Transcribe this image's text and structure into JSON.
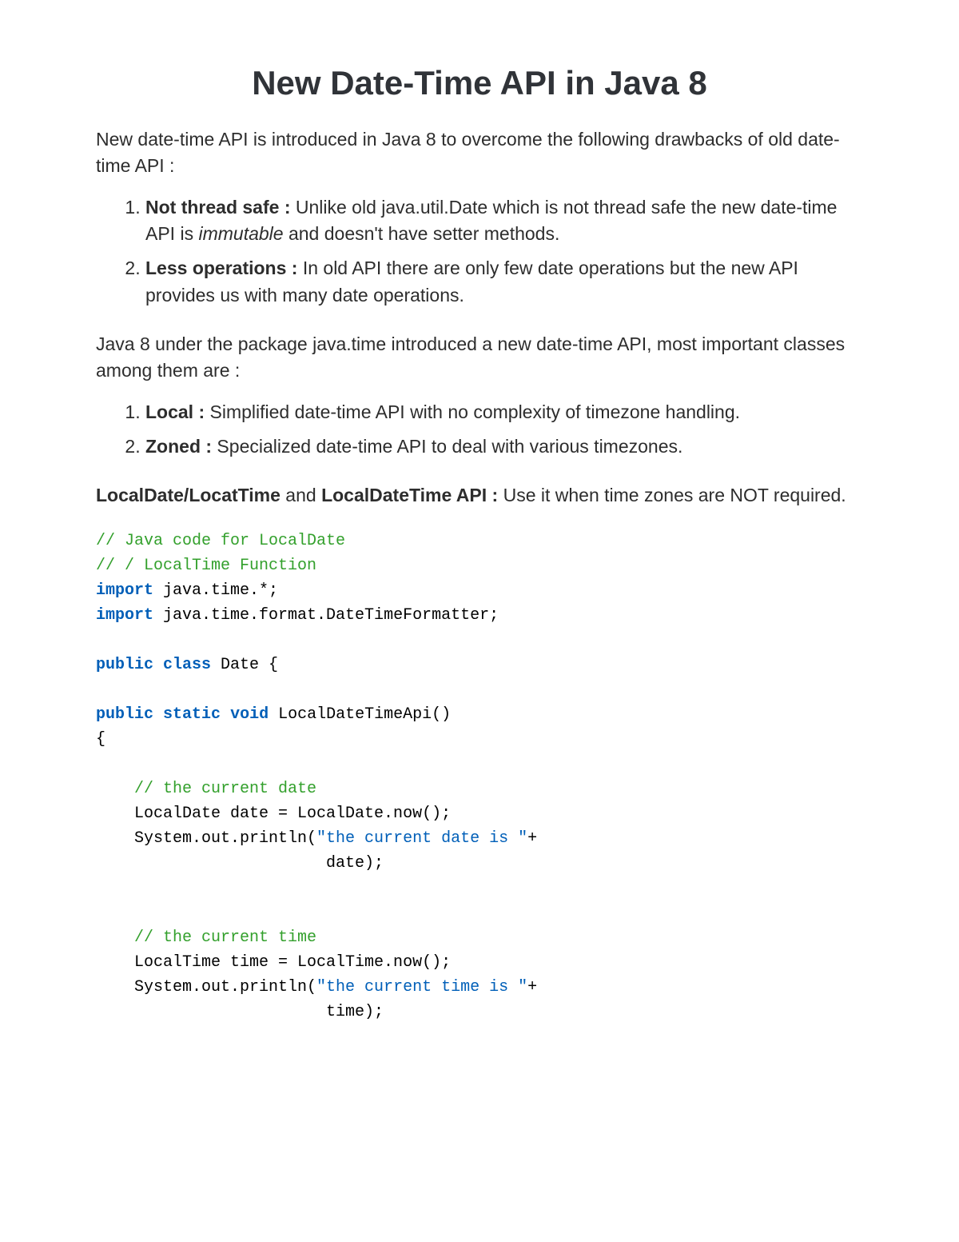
{
  "title": "New Date-Time API in Java 8",
  "intro": "New date-time API is introduced in Java 8 to overcome the following drawbacks of old date-time API :",
  "drawbacks": [
    {
      "label": "Not thread safe :",
      "text_before_em": " Unlike old java.util.Date which is not thread safe the new date-time API is ",
      "em": "immutable",
      "text_after_em": " and doesn't have setter methods."
    },
    {
      "label": "Less operations :",
      "text_before_em": " In old API there are only few date operations but the new API provides us with many date operations.",
      "em": "",
      "text_after_em": ""
    }
  ],
  "mid_para": "Java 8 under the package java.time introduced a new date-time API, most important classes among them are :",
  "classes": [
    {
      "label": "Local :",
      "text": " Simplified date-time API with no complexity of timezone handling."
    },
    {
      "label": "Zoned :",
      "text": " Specialized date-time API to deal with various timezones."
    }
  ],
  "api_line": {
    "bold1": "LocalDate/LocatTime",
    "mid": " and ",
    "bold2": "LocalDateTime API :",
    "tail": " Use it when time zones are NOT required."
  },
  "code": {
    "c1": "// Java code for LocalDate",
    "c2": "// / LocalTime Function",
    "kw_import": "import",
    "imp1": " java.time.*;",
    "imp2": " java.time.format.DateTimeFormatter;",
    "kw_public": "public",
    "kw_class": "class",
    "cls_decl": " Date {",
    "kw_static": "static",
    "kw_void": "void",
    "method_decl": " LocalDateTimeApi()",
    "brace_open": "{",
    "c3": "// the current date",
    "l_date": "    LocalDate date = LocalDate.now();",
    "l_sop1a": "    System.out.println(",
    "s1": "\"the current date is \"",
    "l_sop1b": "+",
    "l_sop1c": "                        date);",
    "c4": "// the current time",
    "l_time": "    LocalTime time = LocalTime.now();",
    "l_sop2a": "    System.out.println(",
    "s2": "\"the current time is \"",
    "l_sop2b": "+",
    "l_sop2c": "                        time);"
  }
}
